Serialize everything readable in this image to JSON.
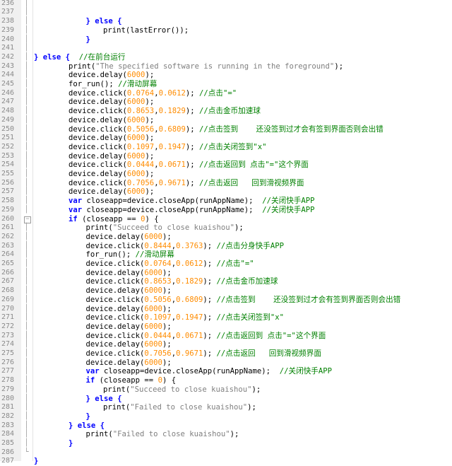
{
  "editor": {
    "lines": [
      {
        "n": "236",
        "indent": 0,
        "fold": "│",
        "t": []
      },
      {
        "n": "237",
        "indent": 0,
        "fold": "│",
        "t": []
      },
      {
        "n": "238",
        "indent": 3,
        "fold": "│",
        "t": [
          [
            "kw",
            "} else {"
          ]
        ]
      },
      {
        "n": "239",
        "indent": 4,
        "fold": "│",
        "t": [
          [
            "plain",
            "print(lastError());"
          ]
        ]
      },
      {
        "n": "240",
        "indent": 3,
        "fold": "│",
        "t": [
          [
            "kw",
            "}"
          ]
        ]
      },
      {
        "n": "241",
        "indent": 0,
        "fold": "│",
        "t": []
      },
      {
        "n": "242",
        "indent": 0,
        "fold": "│",
        "t": [
          [
            "kw",
            "} else {"
          ],
          [
            "plain",
            "  "
          ],
          [
            "cmt",
            "//在前台运行"
          ]
        ]
      },
      {
        "n": "243",
        "indent": 2,
        "fold": "│",
        "t": [
          [
            "plain",
            "print("
          ],
          [
            "str",
            "\"The specified software is running in the foreground\""
          ],
          [
            "plain",
            ");"
          ]
        ]
      },
      {
        "n": "244",
        "indent": 2,
        "fold": "│",
        "t": [
          [
            "plain",
            "device.delay("
          ],
          [
            "num",
            "6000"
          ],
          [
            "plain",
            ");"
          ]
        ]
      },
      {
        "n": "245",
        "indent": 2,
        "fold": "│",
        "t": [
          [
            "plain",
            "for_run(); "
          ],
          [
            "cmt",
            "//滑动屏幕"
          ]
        ]
      },
      {
        "n": "246",
        "indent": 2,
        "fold": "│",
        "t": [
          [
            "plain",
            "device.click("
          ],
          [
            "num",
            "0.0764"
          ],
          [
            "plain",
            ","
          ],
          [
            "num",
            "0.0612"
          ],
          [
            "plain",
            "); "
          ],
          [
            "cmt",
            "//点击\"=\""
          ]
        ]
      },
      {
        "n": "247",
        "indent": 2,
        "fold": "│",
        "t": [
          [
            "plain",
            "device.delay("
          ],
          [
            "num",
            "6000"
          ],
          [
            "plain",
            ");"
          ]
        ]
      },
      {
        "n": "248",
        "indent": 2,
        "fold": "│",
        "t": [
          [
            "plain",
            "device.click("
          ],
          [
            "num",
            "0.8653"
          ],
          [
            "plain",
            ","
          ],
          [
            "num",
            "0.1829"
          ],
          [
            "plain",
            "); "
          ],
          [
            "cmt",
            "//点击金币加速球"
          ]
        ]
      },
      {
        "n": "249",
        "indent": 2,
        "fold": "│",
        "t": [
          [
            "plain",
            "device.delay("
          ],
          [
            "num",
            "6000"
          ],
          [
            "plain",
            ");"
          ]
        ]
      },
      {
        "n": "250",
        "indent": 2,
        "fold": "│",
        "t": [
          [
            "plain",
            "device.click("
          ],
          [
            "num",
            "0.5056"
          ],
          [
            "plain",
            ","
          ],
          [
            "num",
            "0.6809"
          ],
          [
            "plain",
            "); "
          ],
          [
            "cmt",
            "//点击签到    还没签到过才会有签到界面否则会出错"
          ]
        ]
      },
      {
        "n": "251",
        "indent": 2,
        "fold": "│",
        "t": [
          [
            "plain",
            "device.delay("
          ],
          [
            "num",
            "6000"
          ],
          [
            "plain",
            ");"
          ]
        ]
      },
      {
        "n": "252",
        "indent": 2,
        "fold": "│",
        "t": [
          [
            "plain",
            "device.click("
          ],
          [
            "num",
            "0.1097"
          ],
          [
            "plain",
            ","
          ],
          [
            "num",
            "0.1947"
          ],
          [
            "plain",
            "); "
          ],
          [
            "cmt",
            "//点击关闭签到\"x\""
          ]
        ]
      },
      {
        "n": "253",
        "indent": 2,
        "fold": "│",
        "t": [
          [
            "plain",
            "device.delay("
          ],
          [
            "num",
            "6000"
          ],
          [
            "plain",
            ");"
          ]
        ]
      },
      {
        "n": "254",
        "indent": 2,
        "fold": "│",
        "t": [
          [
            "plain",
            "device.click("
          ],
          [
            "num",
            "0.0444"
          ],
          [
            "plain",
            ","
          ],
          [
            "num",
            "0.0671"
          ],
          [
            "plain",
            "); "
          ],
          [
            "cmt",
            "//点击返回到 点击\"=\"这个界面"
          ]
        ]
      },
      {
        "n": "255",
        "indent": 2,
        "fold": "│",
        "t": [
          [
            "plain",
            "device.delay("
          ],
          [
            "num",
            "6000"
          ],
          [
            "plain",
            ");"
          ]
        ]
      },
      {
        "n": "256",
        "indent": 2,
        "fold": "│",
        "t": [
          [
            "plain",
            "device.click("
          ],
          [
            "num",
            "0.7056"
          ],
          [
            "plain",
            ","
          ],
          [
            "num",
            "0.9671"
          ],
          [
            "plain",
            "); "
          ],
          [
            "cmt",
            "//点击返回   回到滑视频界面"
          ]
        ]
      },
      {
        "n": "257",
        "indent": 2,
        "fold": "│",
        "t": [
          [
            "plain",
            "device.delay("
          ],
          [
            "num",
            "6000"
          ],
          [
            "plain",
            ");"
          ]
        ]
      },
      {
        "n": "258",
        "indent": 2,
        "fold": "│",
        "t": [
          [
            "kw",
            "var"
          ],
          [
            "plain",
            " closeapp=device.closeApp(runAppName);  "
          ],
          [
            "cmt",
            "//关闭快手APP"
          ]
        ]
      },
      {
        "n": "259",
        "indent": 2,
        "fold": "│",
        "t": [
          [
            "kw",
            "var"
          ],
          [
            "plain",
            " closeapp=device.closeApp(runAppName);  "
          ],
          [
            "cmt",
            "//关闭快手APP"
          ]
        ]
      },
      {
        "n": "260",
        "indent": 2,
        "fold": "box",
        "t": [
          [
            "kw",
            "if"
          ],
          [
            "plain",
            " (closeapp == "
          ],
          [
            "num",
            "0"
          ],
          [
            "plain",
            ") {"
          ]
        ]
      },
      {
        "n": "261",
        "indent": 3,
        "fold": "│",
        "t": [
          [
            "plain",
            "print("
          ],
          [
            "str",
            "\"Succeed to close kuaishou\""
          ],
          [
            "plain",
            ");"
          ]
        ]
      },
      {
        "n": "262",
        "indent": 3,
        "fold": "│",
        "t": [
          [
            "plain",
            "device.delay("
          ],
          [
            "num",
            "6000"
          ],
          [
            "plain",
            ");"
          ]
        ]
      },
      {
        "n": "263",
        "indent": 3,
        "fold": "│",
        "t": [
          [
            "plain",
            "device.click("
          ],
          [
            "num",
            "0.8444"
          ],
          [
            "plain",
            ","
          ],
          [
            "num",
            "0.3763"
          ],
          [
            "plain",
            "); "
          ],
          [
            "cmt",
            "//点击分身快手APP"
          ]
        ]
      },
      {
        "n": "264",
        "indent": 3,
        "fold": "│",
        "t": [
          [
            "plain",
            "for_run(); "
          ],
          [
            "cmt",
            "//滑动屏幕"
          ]
        ]
      },
      {
        "n": "265",
        "indent": 3,
        "fold": "│",
        "t": [
          [
            "plain",
            "device.click("
          ],
          [
            "num",
            "0.0764"
          ],
          [
            "plain",
            ","
          ],
          [
            "num",
            "0.0612"
          ],
          [
            "plain",
            "); "
          ],
          [
            "cmt",
            "//点击\"=\""
          ]
        ]
      },
      {
        "n": "266",
        "indent": 3,
        "fold": "│",
        "t": [
          [
            "plain",
            "device.delay("
          ],
          [
            "num",
            "6000"
          ],
          [
            "plain",
            ");"
          ]
        ]
      },
      {
        "n": "267",
        "indent": 3,
        "fold": "│",
        "t": [
          [
            "plain",
            "device.click("
          ],
          [
            "num",
            "0.8653"
          ],
          [
            "plain",
            ","
          ],
          [
            "num",
            "0.1829"
          ],
          [
            "plain",
            "); "
          ],
          [
            "cmt",
            "//点击金币加速球"
          ]
        ]
      },
      {
        "n": "268",
        "indent": 3,
        "fold": "│",
        "t": [
          [
            "plain",
            "device.delay("
          ],
          [
            "num",
            "6000"
          ],
          [
            "plain",
            ");"
          ]
        ]
      },
      {
        "n": "269",
        "indent": 3,
        "fold": "│",
        "t": [
          [
            "plain",
            "device.click("
          ],
          [
            "num",
            "0.5056"
          ],
          [
            "plain",
            ","
          ],
          [
            "num",
            "0.6809"
          ],
          [
            "plain",
            "); "
          ],
          [
            "cmt",
            "//点击签到    还没签到过才会有签到界面否则会出错"
          ]
        ]
      },
      {
        "n": "270",
        "indent": 3,
        "fold": "│",
        "t": [
          [
            "plain",
            "device.delay("
          ],
          [
            "num",
            "6000"
          ],
          [
            "plain",
            ");"
          ]
        ]
      },
      {
        "n": "271",
        "indent": 3,
        "fold": "│",
        "t": [
          [
            "plain",
            "device.click("
          ],
          [
            "num",
            "0.1097"
          ],
          [
            "plain",
            ","
          ],
          [
            "num",
            "0.1947"
          ],
          [
            "plain",
            "); "
          ],
          [
            "cmt",
            "//点击关闭签到\"x\""
          ]
        ]
      },
      {
        "n": "272",
        "indent": 3,
        "fold": "│",
        "t": [
          [
            "plain",
            "device.delay("
          ],
          [
            "num",
            "6000"
          ],
          [
            "plain",
            ");"
          ]
        ]
      },
      {
        "n": "273",
        "indent": 3,
        "fold": "│",
        "t": [
          [
            "plain",
            "device.click("
          ],
          [
            "num",
            "0.0444"
          ],
          [
            "plain",
            ","
          ],
          [
            "num",
            "0.0671"
          ],
          [
            "plain",
            "); "
          ],
          [
            "cmt",
            "//点击返回到 点击\"=\"这个界面"
          ]
        ]
      },
      {
        "n": "274",
        "indent": 3,
        "fold": "│",
        "t": [
          [
            "plain",
            "device.delay("
          ],
          [
            "num",
            "6000"
          ],
          [
            "plain",
            ");"
          ]
        ]
      },
      {
        "n": "275",
        "indent": 3,
        "fold": "│",
        "t": [
          [
            "plain",
            "device.click("
          ],
          [
            "num",
            "0.7056"
          ],
          [
            "plain",
            ","
          ],
          [
            "num",
            "0.9671"
          ],
          [
            "plain",
            "); "
          ],
          [
            "cmt",
            "//点击返回   回到滑视频界面"
          ]
        ]
      },
      {
        "n": "276",
        "indent": 3,
        "fold": "│",
        "t": [
          [
            "plain",
            "device.delay("
          ],
          [
            "num",
            "6000"
          ],
          [
            "plain",
            ");"
          ]
        ]
      },
      {
        "n": "277",
        "indent": 3,
        "fold": "│",
        "t": [
          [
            "kw",
            "var"
          ],
          [
            "plain",
            " closeapp=device.closeApp(runAppName);  "
          ],
          [
            "cmt",
            "//关闭快手APP"
          ]
        ]
      },
      {
        "n": "278",
        "indent": 3,
        "fold": "│",
        "t": [
          [
            "kw",
            "if"
          ],
          [
            "plain",
            " (closeapp == "
          ],
          [
            "num",
            "0"
          ],
          [
            "plain",
            ") {"
          ]
        ]
      },
      {
        "n": "279",
        "indent": 4,
        "fold": "│",
        "t": [
          [
            "plain",
            "print("
          ],
          [
            "str",
            "\"Succeed to close kuaishou\""
          ],
          [
            "plain",
            ");"
          ]
        ]
      },
      {
        "n": "280",
        "indent": 3,
        "fold": "│",
        "t": [
          [
            "kw",
            "} else {"
          ]
        ]
      },
      {
        "n": "281",
        "indent": 4,
        "fold": "│",
        "t": [
          [
            "plain",
            "print("
          ],
          [
            "str",
            "\"Failed to close kuaishou\""
          ],
          [
            "plain",
            ");"
          ]
        ]
      },
      {
        "n": "282",
        "indent": 3,
        "fold": "│",
        "t": [
          [
            "kw",
            "}"
          ]
        ]
      },
      {
        "n": "283",
        "indent": 2,
        "fold": "│",
        "t": [
          [
            "kw",
            "} else {"
          ]
        ]
      },
      {
        "n": "284",
        "indent": 3,
        "fold": "│",
        "t": [
          [
            "plain",
            "print("
          ],
          [
            "str",
            "\"Failed to close kuaishou\""
          ],
          [
            "plain",
            ");"
          ]
        ]
      },
      {
        "n": "285",
        "indent": 2,
        "fold": "│",
        "t": [
          [
            "kw",
            "}"
          ]
        ]
      },
      {
        "n": "286",
        "indent": 0,
        "fold": "└",
        "t": []
      },
      {
        "n": "287",
        "indent": 0,
        "fold": "",
        "t": [
          [
            "kw",
            "}"
          ]
        ]
      }
    ]
  }
}
